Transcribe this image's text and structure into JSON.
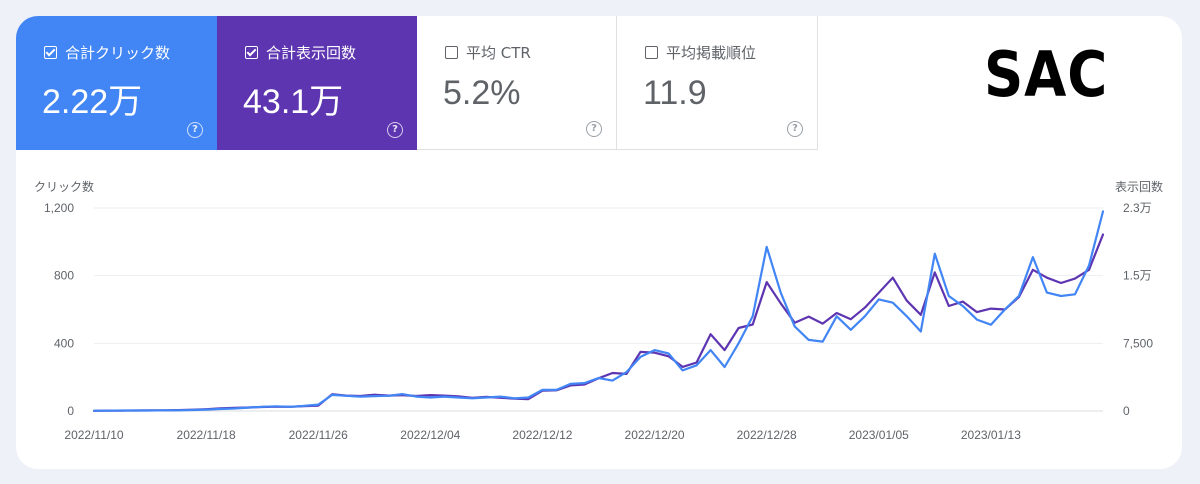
{
  "tiles": [
    {
      "label": "合計クリック数",
      "value": "2.22万",
      "checked": true,
      "color": "#4285f4"
    },
    {
      "label": "合計表示回数",
      "value": "43.1万",
      "checked": true,
      "color": "#5e35b1"
    },
    {
      "label": "平均 CTR",
      "value": "5.2%",
      "checked": false
    },
    {
      "label": "平均掲載順位",
      "value": "11.9",
      "checked": false
    }
  ],
  "logo": "SAC",
  "chart_data": {
    "type": "line",
    "ylabel": "クリック数",
    "y2label": "表示回数",
    "ylim": [
      0,
      1200
    ],
    "y2lim": [
      0,
      23000
    ],
    "yticks": [
      "0",
      "400",
      "800",
      "1,200"
    ],
    "y2ticks": [
      "0",
      "7,500",
      "1.5万",
      "2.3万"
    ],
    "xticks": [
      "2022/11/10",
      "2022/11/18",
      "2022/11/26",
      "2022/12/04",
      "2022/12/12",
      "2022/12/20",
      "2022/12/28",
      "2023/01/05",
      "2023/01/13"
    ],
    "grid": true,
    "series": [
      {
        "name": "合計クリック数",
        "color": "#4285f4",
        "axis": "left",
        "values": [
          2,
          2,
          3,
          3,
          3,
          4,
          4,
          6,
          8,
          12,
          15,
          20,
          25,
          28,
          25,
          30,
          38,
          95,
          90,
          85,
          88,
          90,
          100,
          85,
          80,
          85,
          80,
          75,
          80,
          85,
          75,
          80,
          125,
          125,
          160,
          165,
          195,
          180,
          230,
          320,
          360,
          340,
          240,
          270,
          360,
          260,
          400,
          560,
          970,
          700,
          500,
          420,
          410,
          560,
          480,
          560,
          660,
          640,
          560,
          470,
          930,
          680,
          620,
          540,
          510,
          600,
          680,
          910,
          700,
          680,
          690,
          860,
          1180
        ]
      },
      {
        "name": "合計表示回数",
        "color": "#5e35b1",
        "axis": "right",
        "values": [
          20,
          40,
          50,
          60,
          70,
          80,
          100,
          150,
          200,
          300,
          350,
          400,
          450,
          500,
          480,
          550,
          600,
          1900,
          1750,
          1700,
          1850,
          1750,
          1800,
          1700,
          1800,
          1750,
          1650,
          1500,
          1600,
          1500,
          1400,
          1350,
          2300,
          2350,
          2900,
          3000,
          3700,
          4300,
          4200,
          6700,
          6600,
          6200,
          5000,
          5500,
          8700,
          6900,
          9400,
          9800,
          14600,
          12200,
          10000,
          10700,
          9900,
          11100,
          10400,
          11700,
          13400,
          15100,
          12500,
          10900,
          15700,
          11900,
          12400,
          11200,
          11600,
          11500,
          12900,
          16000,
          15100,
          14500,
          15000,
          16000,
          20000
        ]
      }
    ]
  }
}
